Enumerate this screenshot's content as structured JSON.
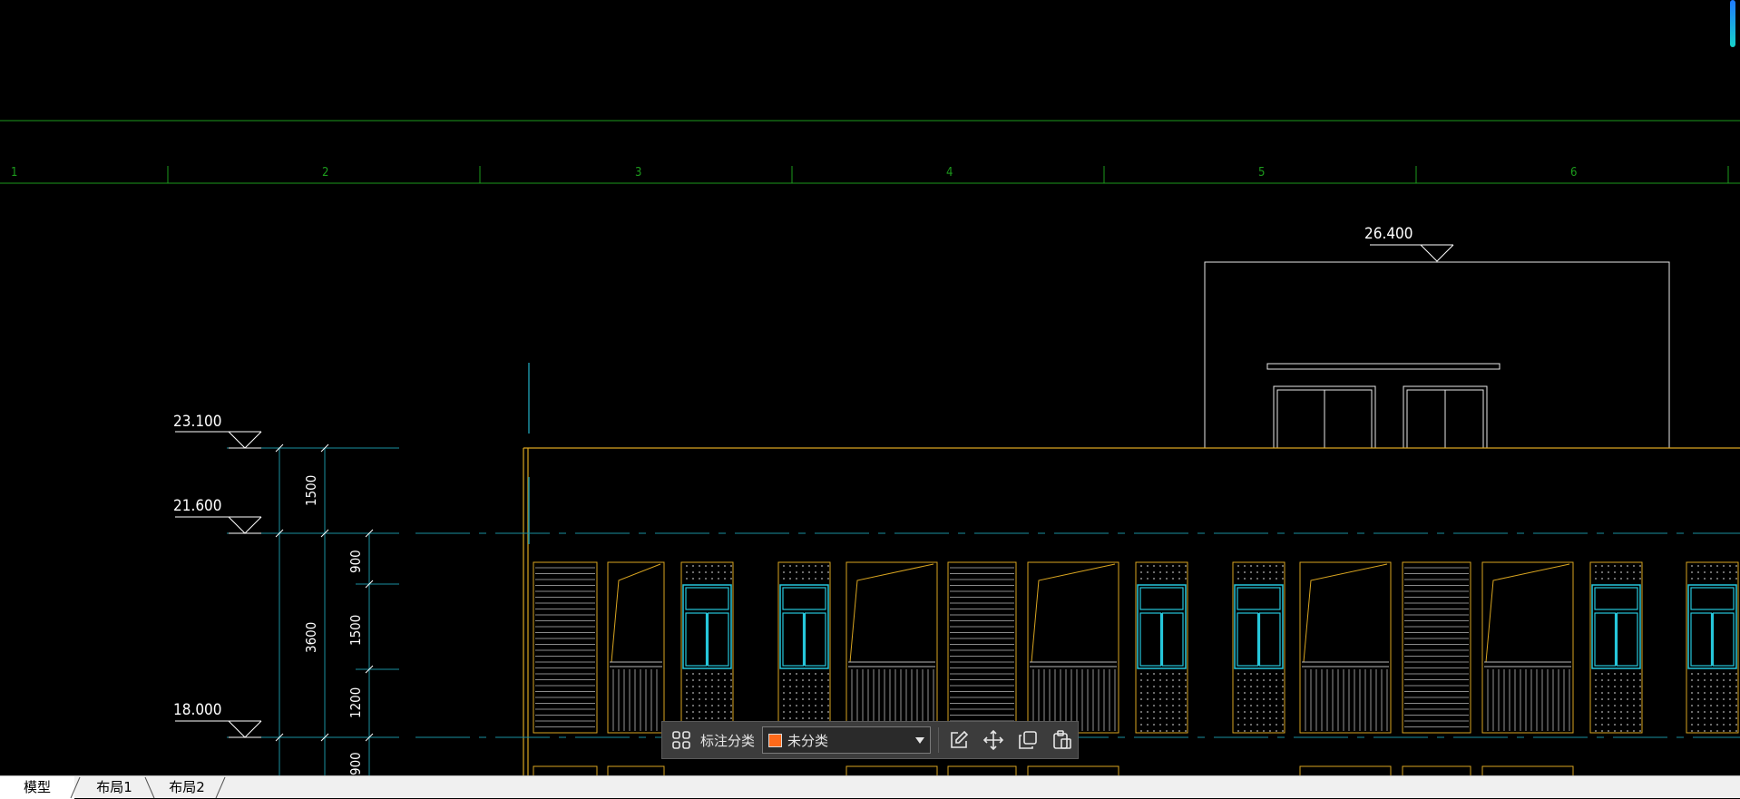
{
  "drawing": {
    "axis_labels": [
      "1",
      "2",
      "3",
      "4",
      "5",
      "6"
    ],
    "elevation_top": "26.400",
    "level_marks": [
      "23.100",
      "21.600",
      "18.000"
    ],
    "vertical_dims": [
      "1500",
      "3600",
      "900",
      "1500",
      "1200",
      "900"
    ]
  },
  "toolbar": {
    "category_label": "标注分类",
    "category_value": "未分类",
    "category_color": "#ff6a1a",
    "icons": [
      "grid-icon",
      "edit-icon",
      "move-icon",
      "copy-icon",
      "paste-icon"
    ]
  },
  "tabs": [
    {
      "label": "模型",
      "active": true
    },
    {
      "label": "布局1",
      "active": false
    },
    {
      "label": "布局2",
      "active": false
    }
  ],
  "colors": {
    "background": "#000000",
    "grid_line": "#1c9a1c",
    "structure": "#d9a520",
    "window": "#26c6da",
    "dimension": "#1a8fa0",
    "annotation_text": "#ffffff"
  }
}
